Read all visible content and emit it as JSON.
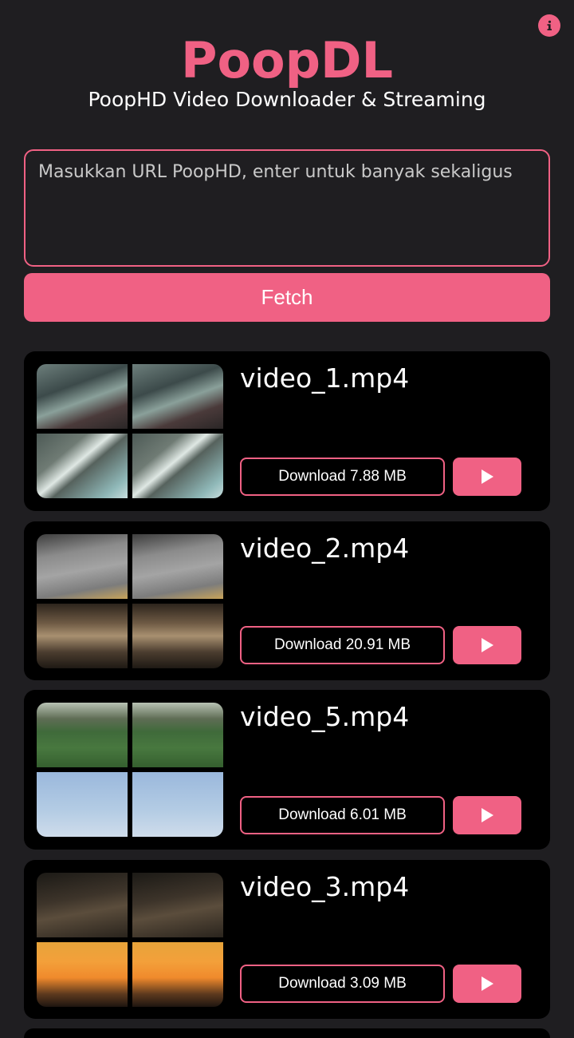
{
  "header": {
    "logo": "PoopDL",
    "subtitle": "PoopHD Video Downloader & Streaming",
    "info_icon": "info-icon"
  },
  "form": {
    "url_placeholder": "Masukkan URL PoopHD, enter untuk banyak sekaligus",
    "fetch_label": "Fetch"
  },
  "colors": {
    "accent": "#f06184",
    "background": "#1f1e21",
    "card": "#000000"
  },
  "videos": [
    {
      "title": "video_1.mp4",
      "download_label": "Download 7.88 MB",
      "play_icon": "play-icon"
    },
    {
      "title": "video_2.mp4",
      "download_label": "Download 20.91 MB",
      "play_icon": "play-icon"
    },
    {
      "title": "video_5.mp4",
      "download_label": "Download 6.01 MB",
      "play_icon": "play-icon"
    },
    {
      "title": "video_3.mp4",
      "download_label": "Download 3.09 MB",
      "play_icon": "play-icon"
    }
  ]
}
